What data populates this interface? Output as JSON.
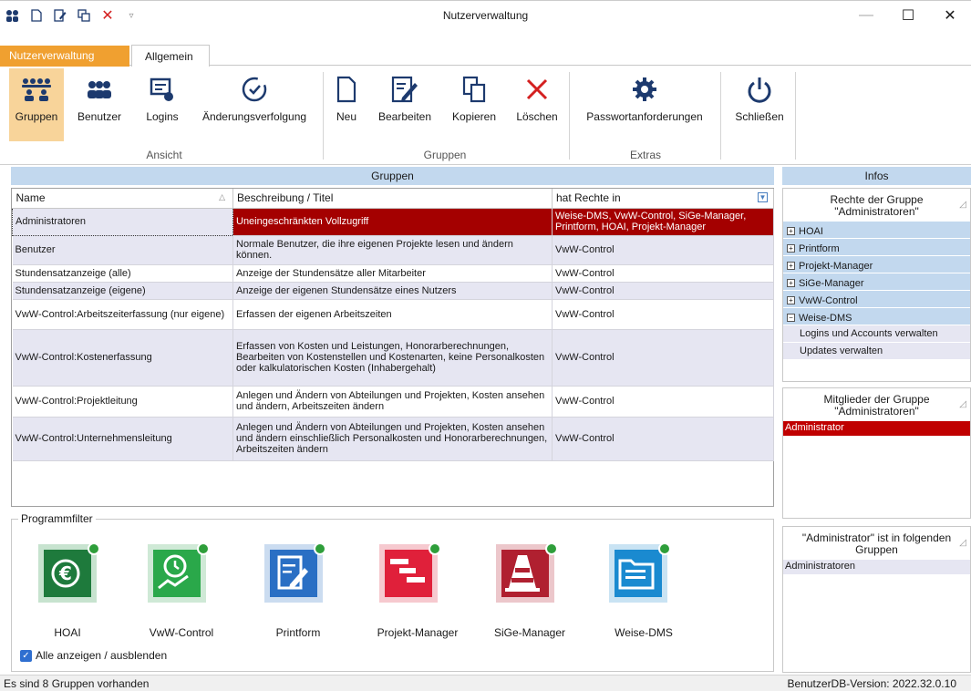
{
  "window": {
    "title": "Nutzerverwaltung"
  },
  "ribbon": {
    "tabs": [
      {
        "label": "Nutzerverwaltung"
      },
      {
        "label": "Allgemein"
      }
    ],
    "buttons": {
      "gruppen": "Gruppen",
      "benutzer": "Benutzer",
      "logins": "Logins",
      "aenderungsverfolgung": "Änderungsverfolgung",
      "neu": "Neu",
      "bearbeiten": "Bearbeiten",
      "kopieren": "Kopieren",
      "loeschen": "Löschen",
      "passwortanforderungen": "Passwortanforderungen",
      "schliessen": "Schließen"
    },
    "groups": {
      "ansicht": "Ansicht",
      "gruppen": "Gruppen",
      "extras": "Extras"
    }
  },
  "main": {
    "panel_title": "Gruppen",
    "columns": [
      "Name",
      "Beschreibung / Titel",
      "hat Rechte in"
    ],
    "rows": [
      {
        "name": "Administratoren",
        "desc": "Uneingeschränkten Vollzugriff",
        "rights": "Weise-DMS, VwW-Control, SiGe-Manager, Printform, HOAI, Projekt-Manager"
      },
      {
        "name": "Benutzer",
        "desc": "Normale Benutzer, die ihre eigenen Projekte lesen und ändern können.",
        "rights": "VwW-Control"
      },
      {
        "name": "Stundensatzanzeige (alle)",
        "desc": "Anzeige der Stundensätze aller Mitarbeiter",
        "rights": "VwW-Control"
      },
      {
        "name": "Stundensatzanzeige (eigene)",
        "desc": "Anzeige der eigenen Stundensätze eines Nutzers",
        "rights": "VwW-Control"
      },
      {
        "name": "VwW-Control:Arbeitszeiterfassung (nur eigene)",
        "desc": "Erfassen der eigenen Arbeitszeiten",
        "rights": "VwW-Control"
      },
      {
        "name": "VwW-Control:Kostenerfassung",
        "desc": "Erfassen von Kosten und Leistungen, Honorarberechnungen, Bearbeiten von Kostenstellen und Kostenarten, keine Personalkosten oder kalkulatorischen Kosten (Inhabergehalt)",
        "rights": "VwW-Control"
      },
      {
        "name": "VwW-Control:Projektleitung",
        "desc": "Anlegen und Ändern von Abteilungen und Projekten, Kosten ansehen und ändern, Arbeitszeiten ändern",
        "rights": "VwW-Control"
      },
      {
        "name": "VwW-Control:Unternehmensleitung",
        "desc": "Anlegen und Ändern von Abteilungen und Projekten, Kosten ansehen und ändern einschließlich Personalkosten und Honorarberechnungen, Arbeitszeiten ändern",
        "rights": "VwW-Control"
      }
    ]
  },
  "filter": {
    "title": "Programmfilter",
    "programs": [
      {
        "label": "HOAI",
        "color": "#1e7a3c"
      },
      {
        "label": "VwW-Control",
        "color": "#2aa84a"
      },
      {
        "label": "Printform",
        "color": "#2a6fc4"
      },
      {
        "label": "Projekt-Manager",
        "color": "#e0203a"
      },
      {
        "label": "SiGe-Manager",
        "color": "#b02030"
      },
      {
        "label": "Weise-DMS",
        "color": "#1a8ad0"
      }
    ],
    "toggle_all": "Alle anzeigen / ausblenden"
  },
  "infos": {
    "title": "Infos",
    "rights_title_1": "Rechte der Gruppe",
    "rights_title_2": "\"Administratoren\"",
    "rights_items": [
      "HOAI",
      "Printform",
      "Projekt-Manager",
      "SiGe-Manager",
      "VwW-Control",
      "Weise-DMS"
    ],
    "rights_children": [
      "Logins und Accounts verwalten",
      "Updates verwalten"
    ],
    "members_title_1": "Mitglieder der Gruppe",
    "members_title_2": "\"Administratoren\"",
    "members": [
      "Administrator"
    ],
    "groups_title_1": "\"Administrator\" ist in folgenden",
    "groups_title_2": "Gruppen",
    "groups": [
      "Administratoren"
    ]
  },
  "status": {
    "left": "Es sind 8 Gruppen vorhanden",
    "right": "BenutzerDB-Version: 2022.32.0.10"
  }
}
